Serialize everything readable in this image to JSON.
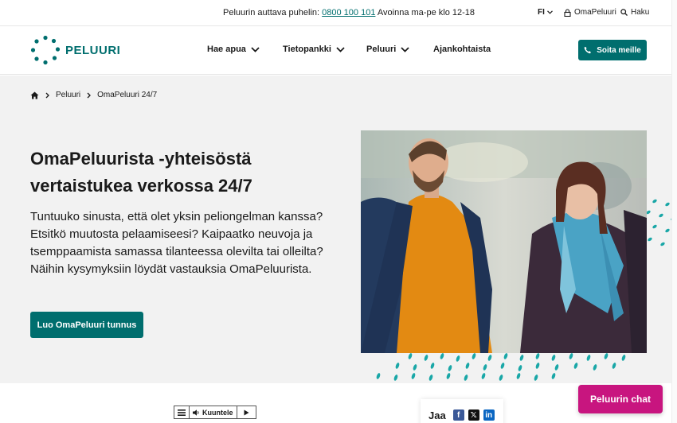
{
  "topbar": {
    "phone_prefix": "Peluurin auttava puhelin:",
    "phone_number": "0800 100 101",
    "phone_suffix": "Avoinna ma-pe klo 12-18",
    "language": "FI",
    "account_label": "OmaPeluuri",
    "search_label": "Haku"
  },
  "header": {
    "logo_text": "PELUURI",
    "nav": [
      {
        "label": "Hae apua"
      },
      {
        "label": "Tietopankki"
      },
      {
        "label": "Peluuri"
      },
      {
        "label": "Ajankohtaista"
      }
    ],
    "call_button": "Soita meille"
  },
  "breadcrumb": [
    "Peluuri",
    "OmaPeluuri 24/7"
  ],
  "hero": {
    "title": "OmaPeluurista -yhteisöstä vertaistukea verkossa 24/7",
    "lead": "Tuntuuko sinusta, että olet yksin peliongelman kanssa? Etsitkö muutosta pelaamiseesi? Kaipaatko neuvoja ja tsemppaamista samassa tilanteessa olevilta tai olleilta? Näihin kysymyksiin löydät vastauksia OmaPeluurista.",
    "cta": "Luo OmaPeluuri tunnus"
  },
  "listen_widget": {
    "label": "Kuuntele"
  },
  "share": {
    "label": "Jaa",
    "icons": [
      "facebook-icon",
      "x-icon",
      "linkedin-icon"
    ]
  },
  "chat_button": "Peluurin chat",
  "colors": {
    "brand": "#006e6e",
    "chat": "#c8157f",
    "hero_bg": "#f2f2f2",
    "dots": "#1aa7a7"
  }
}
